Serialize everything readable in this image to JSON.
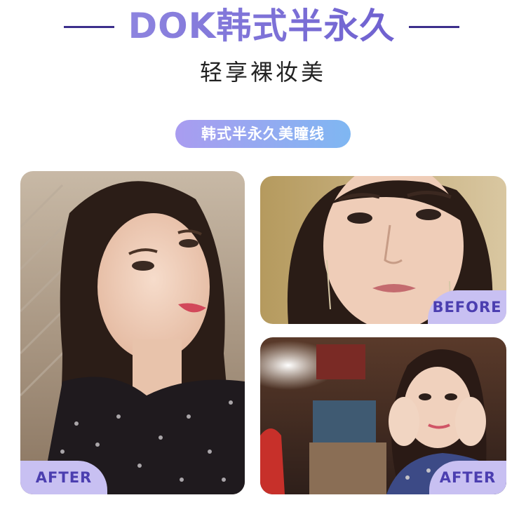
{
  "header": {
    "title": "DOK韩式半永久",
    "subtitle": "轻享裸妆美"
  },
  "pill": {
    "label": "韩式半永久美瞳线"
  },
  "photos": {
    "main": {
      "label": "AFTER"
    },
    "before": {
      "label": "BEFORE"
    },
    "after2": {
      "label": "AFTER"
    }
  },
  "colors": {
    "accent_purple": "#7b6fd1",
    "line_dark": "#3c2f8c",
    "label_bg": "#c8c0f2",
    "label_text": "#4b3eb0",
    "pill_gradient_start": "#a99cf0",
    "pill_gradient_end": "#7fb7f2"
  }
}
